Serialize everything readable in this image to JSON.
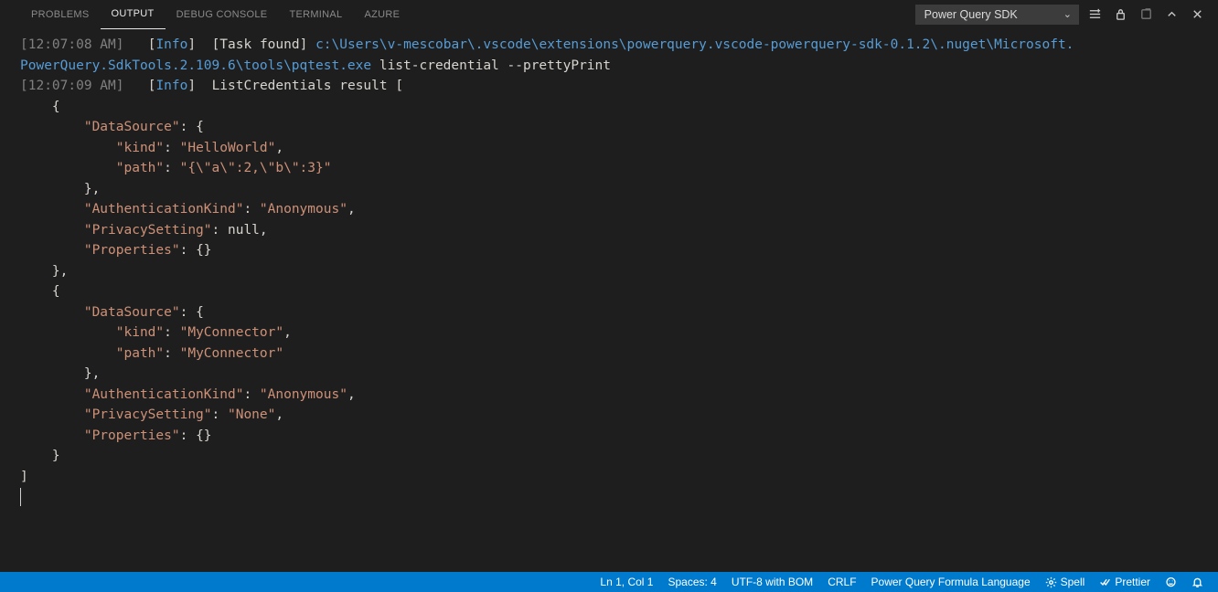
{
  "panel": {
    "tabs": {
      "problems": "PROBLEMS",
      "output": "OUTPUT",
      "debug": "DEBUG CONSOLE",
      "terminal": "TERMINAL",
      "azure": "AZURE"
    },
    "active_tab": "output",
    "dropdown_selected": "Power Query SDK"
  },
  "log": {
    "line1": {
      "ts": "[12:07:08 AM]",
      "lb": "[",
      "level": "Info",
      "rb": "]",
      "task_lb": "[",
      "task": "Task found",
      "task_rb": "]",
      "path_a": "c:\\Users\\v-mescobar\\.vscode\\extensions\\powerquery.vscode-powerquery-sdk-0.1.2\\.nuget\\Microsoft.",
      "path_b": "PowerQuery.SdkTools.2.109.6\\tools\\pqtest.exe",
      "cmd": " list-credential --prettyPrint"
    },
    "line2": {
      "ts": "[12:07:09 AM]",
      "lb": "[",
      "level": "Info",
      "rb": "]",
      "msg": "ListCredentials result ["
    },
    "json": {
      "l1": "    {",
      "l2a": "        \"DataSource\"",
      "l2b": ": {",
      "l3a": "            \"kind\"",
      "l3b": ": ",
      "l3c": "\"HelloWorld\"",
      "l3d": ",",
      "l4a": "            \"path\"",
      "l4b": ": ",
      "l4c": "\"{\\\"a\\\":2,\\\"b\\\":3}\"",
      "l5": "        },",
      "l6a": "        \"AuthenticationKind\"",
      "l6b": ": ",
      "l6c": "\"Anonymous\"",
      "l6d": ",",
      "l7a": "        \"PrivacySetting\"",
      "l7b": ": ",
      "l7c": "null",
      "l7d": ",",
      "l8a": "        \"Properties\"",
      "l8b": ": {}",
      "l9": "    },",
      "l10": "    {",
      "l11a": "        \"DataSource\"",
      "l11b": ": {",
      "l12a": "            \"kind\"",
      "l12b": ": ",
      "l12c": "\"MyConnector\"",
      "l12d": ",",
      "l13a": "            \"path\"",
      "l13b": ": ",
      "l13c": "\"MyConnector\"",
      "l14": "        },",
      "l15a": "        \"AuthenticationKind\"",
      "l15b": ": ",
      "l15c": "\"Anonymous\"",
      "l15d": ",",
      "l16a": "        \"PrivacySetting\"",
      "l16b": ": ",
      "l16c": "\"None\"",
      "l16d": ",",
      "l17a": "        \"Properties\"",
      "l17b": ": {}",
      "l18": "    }",
      "close": "]"
    }
  },
  "statusbar": {
    "ln": "Ln 1, Col 1",
    "spaces": "Spaces: 4",
    "encoding": "UTF-8 with BOM",
    "eol": "CRLF",
    "language": "Power Query Formula Language",
    "spell": "Spell",
    "prettier": "Prettier"
  }
}
